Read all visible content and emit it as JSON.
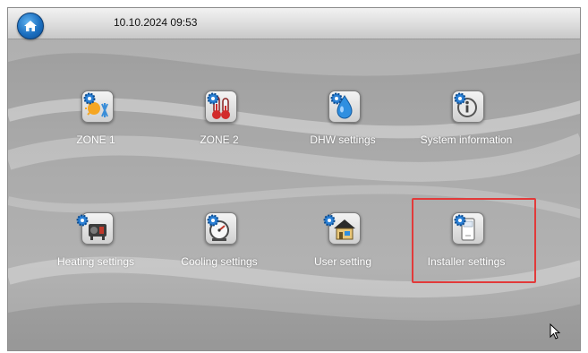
{
  "header": {
    "datetime": "10.10.2024 09:53",
    "home_icon": "home-icon"
  },
  "tiles": [
    {
      "label": "ZONE 1",
      "icon": "zone-sun-snow-icon"
    },
    {
      "label": "ZONE 2",
      "icon": "zone-thermometer-icon"
    },
    {
      "label": "DHW settings",
      "icon": "water-drop-icon"
    },
    {
      "label": "System information",
      "icon": "info-icon"
    },
    {
      "label": "Heating settings",
      "icon": "heat-pump-icon"
    },
    {
      "label": "Cooling settings",
      "icon": "gauge-icon"
    },
    {
      "label": "User setting",
      "icon": "house-user-icon"
    },
    {
      "label": "Installer settings",
      "icon": "installer-device-icon"
    }
  ],
  "highlighted_tile": "Installer settings",
  "colors": {
    "home_button": "#1c6fc0",
    "highlight_box": "#e23a3a",
    "gear": "#2a7fd4"
  }
}
